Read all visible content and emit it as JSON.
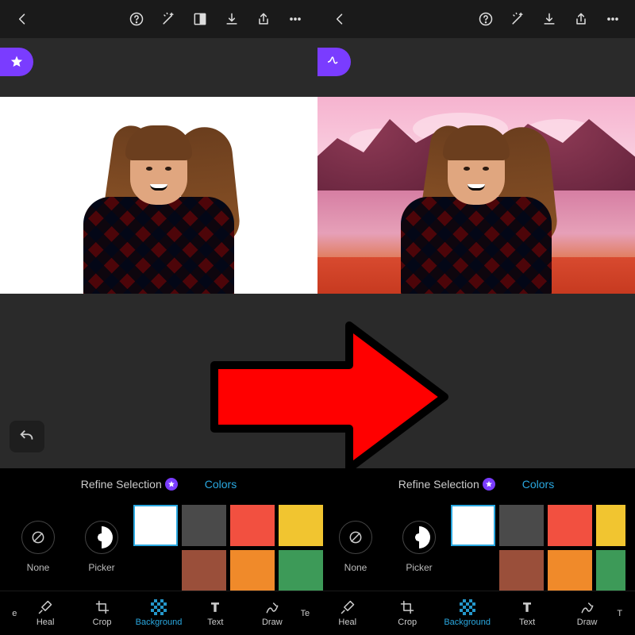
{
  "topbar": {
    "icons": [
      "back",
      "help",
      "magic",
      "compare",
      "download",
      "share",
      "more"
    ]
  },
  "topbar_right": {
    "icons": [
      "back",
      "help",
      "magic",
      "download",
      "share",
      "more"
    ]
  },
  "panel": {
    "refine_label": "Refine Selection",
    "colors_label": "Colors",
    "none_label": "None",
    "picker_label": "Picker",
    "swatches": [
      {
        "c": "#ffffff",
        "selected": true
      },
      {
        "c": "#4a4a4a"
      },
      {
        "c": "#f25040"
      },
      {
        "c": "#f1c530"
      },
      {
        "c": "#000000"
      },
      {
        "c": "#9a4f3a"
      },
      {
        "c": "#f08a2a"
      },
      {
        "c": "#3d9a58"
      }
    ]
  },
  "tools": {
    "frag_left": "e",
    "heal": "Heal",
    "crop": "Crop",
    "background": "Background",
    "text": "Text",
    "draw": "Draw",
    "frag_right": "Te",
    "frag_right2": "T"
  }
}
